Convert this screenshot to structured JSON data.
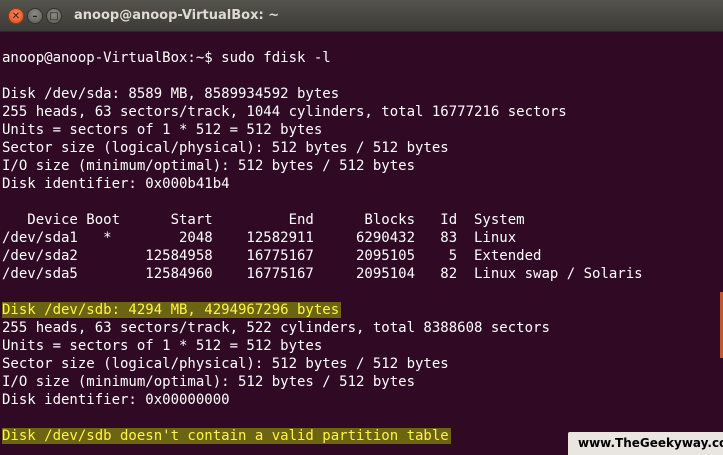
{
  "window": {
    "title": "anoop@anoop-VirtualBox: ~",
    "close_glyph": "✕",
    "minimize_glyph": "–",
    "maximize_glyph": "□"
  },
  "terminal": {
    "lines": [
      {
        "text": "anoop@anoop-VirtualBox:~$ sudo fdisk -l"
      },
      {
        "text": ""
      },
      {
        "text": "Disk /dev/sda: 8589 MB, 8589934592 bytes"
      },
      {
        "text": "255 heads, 63 sectors/track, 1044 cylinders, total 16777216 sectors"
      },
      {
        "text": "Units = sectors of 1 * 512 = 512 bytes"
      },
      {
        "text": "Sector size (logical/physical): 512 bytes / 512 bytes"
      },
      {
        "text": "I/O size (minimum/optimal): 512 bytes / 512 bytes"
      },
      {
        "text": "Disk identifier: 0x000b41b4"
      },
      {
        "text": ""
      },
      {
        "text": "   Device Boot      Start         End      Blocks   Id  System"
      },
      {
        "text": "/dev/sda1   *        2048    12582911     6290432   83  Linux"
      },
      {
        "text": "/dev/sda2        12584958    16775167     2095105    5  Extended"
      },
      {
        "text": "/dev/sda5        12584960    16775167     2095104   82  Linux swap / Solaris"
      },
      {
        "text": ""
      },
      {
        "text": "Disk /dev/sdb: 4294 MB, 4294967296 bytes",
        "highlight": true
      },
      {
        "text": "255 heads, 63 sectors/track, 522 cylinders, total 8388608 sectors"
      },
      {
        "text": "Units = sectors of 1 * 512 = 512 bytes"
      },
      {
        "text": "Sector size (logical/physical): 512 bytes / 512 bytes"
      },
      {
        "text": "I/O size (minimum/optimal): 512 bytes / 512 bytes"
      },
      {
        "text": "Disk identifier: 0x00000000"
      },
      {
        "text": ""
      },
      {
        "text": "Disk /dev/sdb doesn't contain a valid partition table",
        "highlight": true
      }
    ]
  },
  "watermark": {
    "text": "www.TheGeekyway.com"
  },
  "colors": {
    "terminal_background": "#300a24",
    "terminal_text": "#ffffff",
    "highlight_text": "#fff34a",
    "highlight_background": "#6b6511",
    "titlebar": "#3c3b37"
  }
}
